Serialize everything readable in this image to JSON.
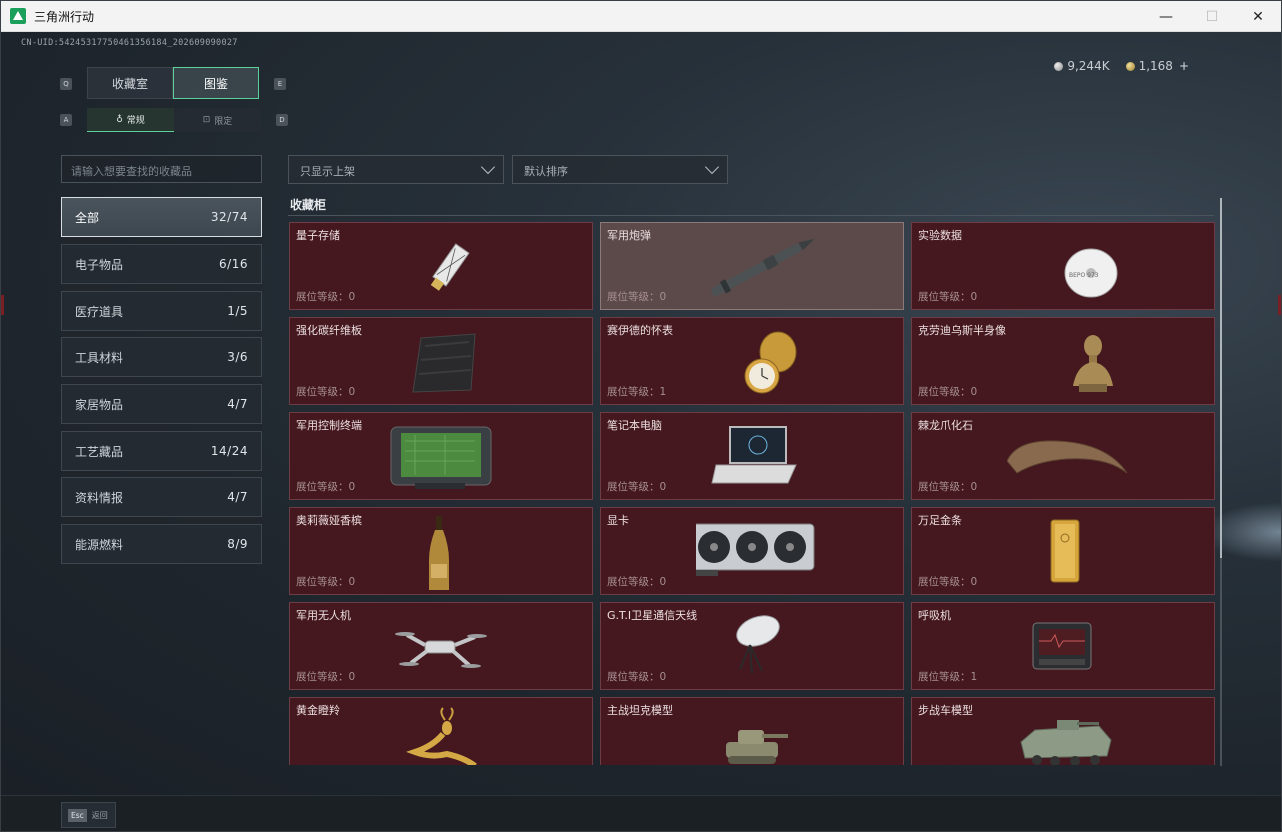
{
  "window": {
    "title": "三角洲行动",
    "controls": {
      "minimize": "—",
      "maximize": "☐",
      "close": "✕"
    }
  },
  "header": {
    "uid": "CN-UID:5424531775046135618​4_202609090027",
    "silver": "9,244K",
    "gold": "1,168",
    "plus": "+"
  },
  "tabs_main": [
    {
      "label": "收藏室",
      "active": false
    },
    {
      "label": "图鉴",
      "active": true
    }
  ],
  "tabs_sub": [
    {
      "label": "常规",
      "active": true
    },
    {
      "label": "限定",
      "active": false
    }
  ],
  "key_hints": {
    "q": "Q",
    "e": "E",
    "a": "A",
    "d": "D"
  },
  "search": {
    "placeholder": "请输入想要查找的收藏品"
  },
  "filters": {
    "display": "只显示上架",
    "sort": "默认排序"
  },
  "categories": [
    {
      "label": "全部",
      "count": "32/74",
      "active": true
    },
    {
      "label": "电子物品",
      "count": "6/16"
    },
    {
      "label": "医疗道具",
      "count": "1/5"
    },
    {
      "label": "工具材料",
      "count": "3/6"
    },
    {
      "label": "家居物品",
      "count": "4/7"
    },
    {
      "label": "工艺藏品",
      "count": "14/24"
    },
    {
      "label": "资料情报",
      "count": "4/7"
    },
    {
      "label": "能源燃料",
      "count": "8/9"
    }
  ],
  "section": {
    "title": "收藏柜"
  },
  "items": [
    {
      "name": "量子存储",
      "level": "展位等级：0",
      "icon": "usb-drive-icon"
    },
    {
      "name": "军用炮弹",
      "level": "展位等级：0",
      "icon": "artillery-shell-icon"
    },
    {
      "name": "实验数据",
      "level": "展位等级：0",
      "icon": "disc-icon"
    },
    {
      "name": "强化碳纤维板",
      "level": "展位等级：0",
      "icon": "carbon-plate-icon"
    },
    {
      "name": "赛伊德的怀表",
      "level": "展位等级：1",
      "icon": "pocket-watch-icon"
    },
    {
      "name": "克劳迪乌斯半身像",
      "level": "展位等级：0",
      "icon": "bust-icon"
    },
    {
      "name": "军用控制终端",
      "level": "展位等级：0",
      "icon": "control-terminal-icon"
    },
    {
      "name": "笔记本电脑",
      "level": "展位等级：0",
      "icon": "laptop-icon"
    },
    {
      "name": "棘龙爪化石",
      "level": "展位等级：0",
      "icon": "claw-fossil-icon"
    },
    {
      "name": "奥莉薇娅香槟",
      "level": "展位等级：0",
      "icon": "champagne-icon"
    },
    {
      "name": "显卡",
      "level": "展位等级：0",
      "icon": "graphics-card-icon"
    },
    {
      "name": "万足金条",
      "level": "展位等级：0",
      "icon": "gold-bar-icon"
    },
    {
      "name": "军用无人机",
      "level": "展位等级：0",
      "icon": "drone-icon"
    },
    {
      "name": "G.T.I卫星通信天线",
      "level": "展位等级：0",
      "icon": "satellite-dish-icon"
    },
    {
      "name": "呼吸机",
      "level": "展位等级：1",
      "icon": "ventilator-icon"
    },
    {
      "name": "黄金瞪羚",
      "level": "",
      "icon": "gold-gazelle-icon"
    },
    {
      "name": "主战坦克模型",
      "level": "",
      "icon": "tank-model-icon"
    },
    {
      "name": "步战车模型",
      "level": "",
      "icon": "ifv-model-icon"
    }
  ],
  "footer": {
    "esc_key": "Esc",
    "esc_label": "返回"
  }
}
